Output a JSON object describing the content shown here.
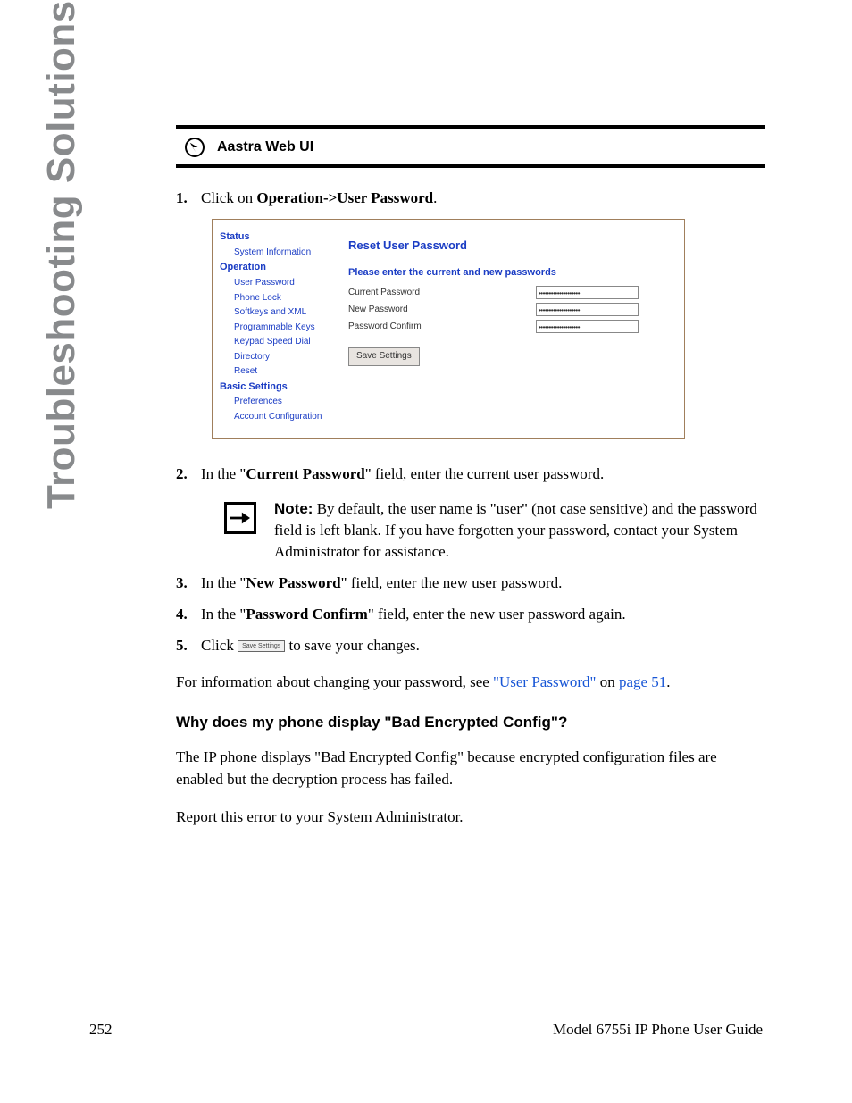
{
  "sidebar_title": "Troubleshooting Solutions",
  "section_label": "Aastra Web UI",
  "steps": {
    "s1": {
      "num": "1.",
      "prefix": "Click on ",
      "bold": "Operation->User Password",
      "suffix": "."
    },
    "s2": {
      "num": "2.",
      "prefix": "In the \"",
      "bold": "Current Password",
      "suffix": "\" field, enter the current user password."
    },
    "s3": {
      "num": "3.",
      "prefix": "In the \"",
      "bold": "New Password",
      "suffix": "\" field, enter the new user password."
    },
    "s4": {
      "num": "4.",
      "prefix": "In the \"",
      "bold": "Password Confirm",
      "suffix": "\" field, enter the new user password again."
    },
    "s5": {
      "num": "5.",
      "prefix": "Click ",
      "btn": "Save Settings",
      "suffix": " to save your changes."
    }
  },
  "note": {
    "label": "Note:",
    "text": " By default, the user name is \"user\" (not case sensitive) and the password field is left blank. If you have forgotten your password, contact your System Administrator for assistance."
  },
  "screenshot": {
    "nav": {
      "status": "Status",
      "system_info": "System Information",
      "operation": "Operation",
      "user_password": "User Password",
      "phone_lock": "Phone Lock",
      "softkeys_xml": "Softkeys and XML",
      "programmable_keys": "Programmable Keys",
      "keypad_speed_dial": "Keypad Speed Dial",
      "directory": "Directory",
      "reset": "Reset",
      "basic_settings": "Basic Settings",
      "preferences": "Preferences",
      "account_config": "Account Configuration"
    },
    "panel": {
      "title": "Reset User Password",
      "subtitle": "Please enter the current and new passwords",
      "current": "Current Password",
      "newpw": "New Password",
      "confirm": "Password Confirm",
      "mask": "••••••••••••••••••••",
      "save": "Save Settings"
    }
  },
  "para_info_prefix": "For information about changing your password, see ",
  "para_info_link": "\"User Password\"",
  "para_info_on": " on ",
  "para_info_page": "page 51",
  "para_info_suffix": ".",
  "heading_bad": "Why does my phone display \"Bad Encrypted Config\"?",
  "para_bad": "The IP phone displays \"Bad Encrypted Config\" because encrypted configuration files are enabled but the decryption process has failed.",
  "para_report": "Report this error to your System Administrator.",
  "footer": {
    "page": "252",
    "title": "Model 6755i IP Phone User Guide"
  }
}
